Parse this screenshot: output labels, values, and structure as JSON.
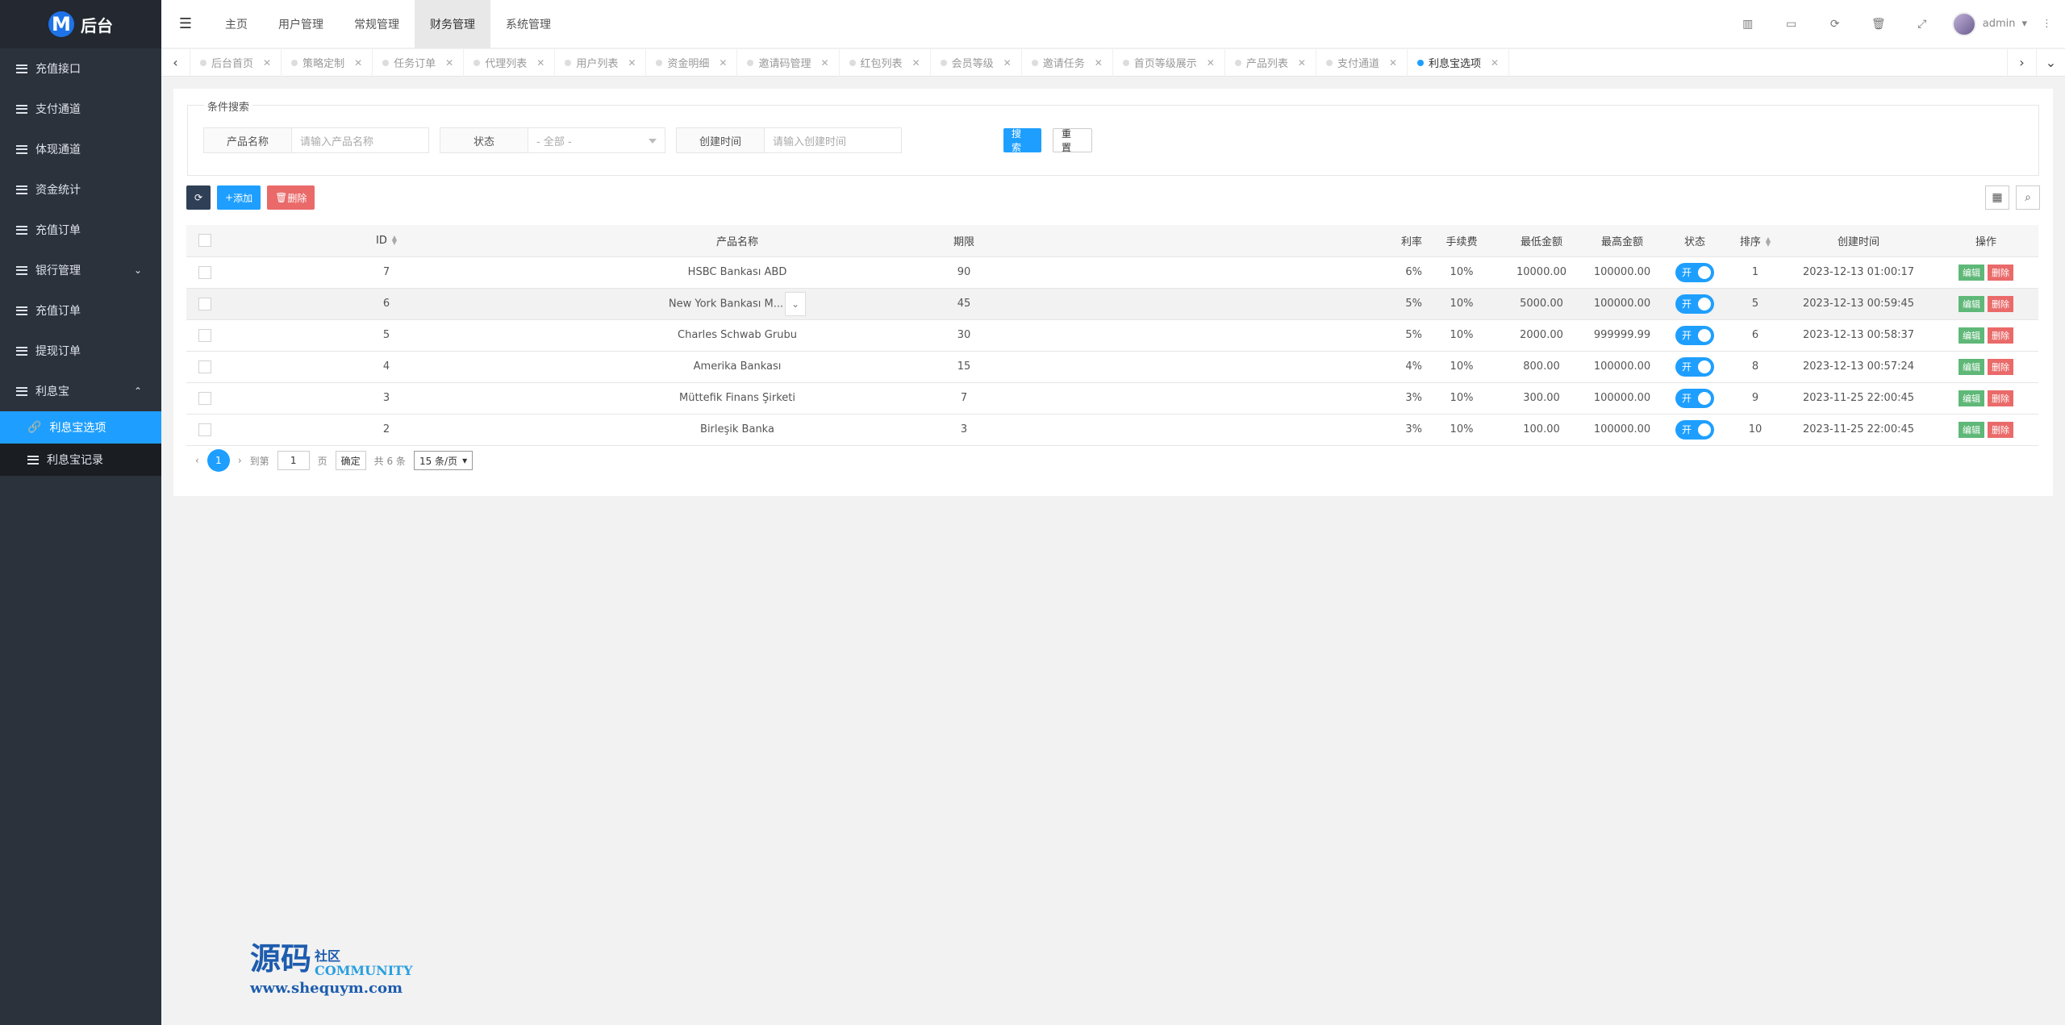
{
  "app": {
    "title": "后台"
  },
  "sidebar": {
    "items": [
      {
        "label": "充值接口"
      },
      {
        "label": "支付通道"
      },
      {
        "label": "体现通道"
      },
      {
        "label": "资金统计"
      },
      {
        "label": "充值订单"
      },
      {
        "label": "银行管理"
      },
      {
        "label": "充值订单"
      },
      {
        "label": "提现订单"
      },
      {
        "label": "利息宝"
      }
    ],
    "sub_items": [
      {
        "label": "利息宝选项"
      },
      {
        "label": "利息宝记录"
      }
    ]
  },
  "topnav": {
    "items": [
      {
        "label": "主页"
      },
      {
        "label": "用户管理"
      },
      {
        "label": "常规管理"
      },
      {
        "label": "财务管理"
      },
      {
        "label": "系统管理"
      }
    ],
    "user": "admin"
  },
  "tabs": [
    {
      "label": "后台首页"
    },
    {
      "label": "策略定制"
    },
    {
      "label": "任务订单"
    },
    {
      "label": "代理列表"
    },
    {
      "label": "用户列表"
    },
    {
      "label": "资金明细"
    },
    {
      "label": "邀请码管理"
    },
    {
      "label": "红包列表"
    },
    {
      "label": "会员等级"
    },
    {
      "label": "邀请任务"
    },
    {
      "label": "首页等级展示"
    },
    {
      "label": "产品列表"
    },
    {
      "label": "支付通道"
    },
    {
      "label": "利息宝选项"
    }
  ],
  "search": {
    "legend": "条件搜索",
    "name_label": "产品名称",
    "name_placeholder": "请输入产品名称",
    "status_label": "状态",
    "status_value": "- 全部 -",
    "time_label": "创建时间",
    "time_placeholder": "请输入创建时间",
    "search_btn": "搜 索",
    "reset_btn": "重 置"
  },
  "toolbar": {
    "add": "添加",
    "delete": "删除"
  },
  "table": {
    "headers": [
      "ID",
      "产品名称",
      "期限",
      "利率",
      "手续费",
      "最低金额",
      "最高金额",
      "状态",
      "排序",
      "创建时间",
      "操作"
    ],
    "switch_label": "开",
    "edit_label": "编辑",
    "delete_label": "删除",
    "rows": [
      {
        "id": "7",
        "name": "HSBC Bankası ABD",
        "term": "90",
        "rate": "6%",
        "fee": "10%",
        "min": "10000.00",
        "max": "100000.00",
        "sort": "1",
        "created": "2023-12-13 01:00:17"
      },
      {
        "id": "6",
        "name": "New York Bankası M...",
        "term": "45",
        "rate": "5%",
        "fee": "10%",
        "min": "5000.00",
        "max": "100000.00",
        "sort": "5",
        "created": "2023-12-13 00:59:45"
      },
      {
        "id": "5",
        "name": "Charles Schwab Grubu",
        "term": "30",
        "rate": "5%",
        "fee": "10%",
        "min": "2000.00",
        "max": "999999.99",
        "sort": "6",
        "created": "2023-12-13 00:58:37"
      },
      {
        "id": "4",
        "name": "Amerika Bankası",
        "term": "15",
        "rate": "4%",
        "fee": "10%",
        "min": "800.00",
        "max": "100000.00",
        "sort": "8",
        "created": "2023-12-13 00:57:24"
      },
      {
        "id": "3",
        "name": "Müttefik Finans Şirketi",
        "term": "7",
        "rate": "3%",
        "fee": "10%",
        "min": "300.00",
        "max": "100000.00",
        "sort": "9",
        "created": "2023-11-25 22:00:45"
      },
      {
        "id": "2",
        "name": "Birleşik Banka",
        "term": "3",
        "rate": "3%",
        "fee": "10%",
        "min": "100.00",
        "max": "100000.00",
        "sort": "10",
        "created": "2023-11-25 22:00:45"
      }
    ]
  },
  "pager": {
    "current": "1",
    "goto_label": "到第",
    "goto_value": "1",
    "page_label": "页",
    "confirm": "确定",
    "total": "共 6 条",
    "per_page": "15 条/页"
  },
  "watermark": {
    "title": "源码",
    "sub1": "社区",
    "sub2": "COMMUNITY",
    "url": "www.shequym.com"
  }
}
